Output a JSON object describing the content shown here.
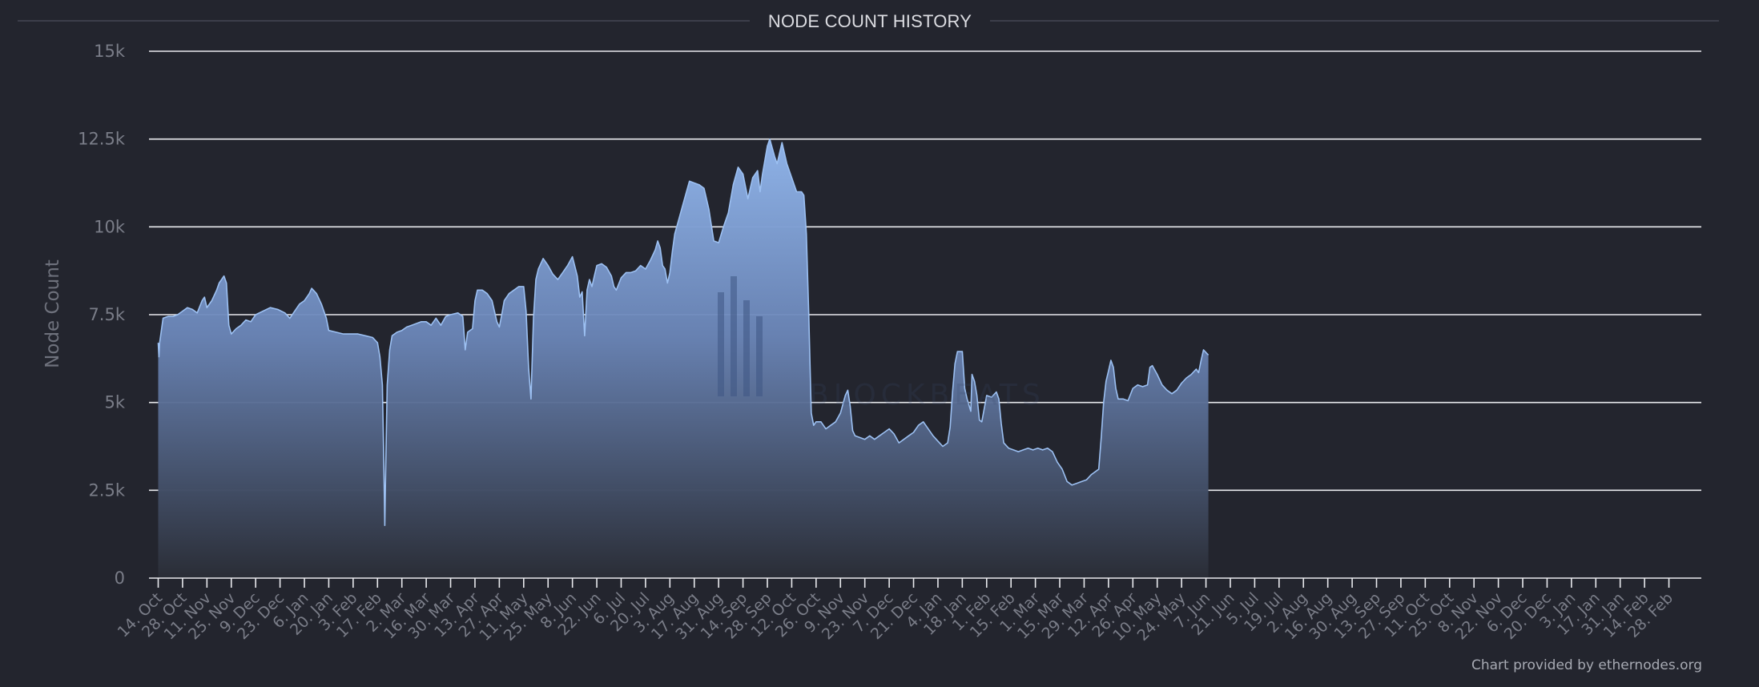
{
  "chart_data": {
    "type": "area",
    "title": "NODE COUNT HISTORY",
    "ylabel": "Node Count",
    "ylim": [
      0,
      15000
    ],
    "yticks": [
      0,
      2500,
      5000,
      7500,
      10000,
      12500,
      15000
    ],
    "ytick_labels": [
      "0",
      "2.5k",
      "5k",
      "7.5k",
      "10k",
      "12.5k",
      "15k"
    ],
    "xtick_labels": [
      "14. Oct",
      "28. Oct",
      "11. Nov",
      "25. Nov",
      "9. Dec",
      "23. Dec",
      "6. Jan",
      "20. Jan",
      "3. Feb",
      "17. Feb",
      "2. Mar",
      "16. Mar",
      "30. Mar",
      "13. Apr",
      "27. Apr",
      "11. May",
      "25. May",
      "8. Jun",
      "22. Jun",
      "6. Jul",
      "20. Jul",
      "3. Aug",
      "17. Aug",
      "31. Aug",
      "14. Sep",
      "28. Sep",
      "12. Oct",
      "26. Oct",
      "9. Nov",
      "23. Nov",
      "7. Dec",
      "21. Dec",
      "4. Jan",
      "18. Jan",
      "1. Feb",
      "15. Feb",
      "1. Mar",
      "15. Mar",
      "29. Mar",
      "12. Apr",
      "26. Apr",
      "10. May",
      "24. May",
      "7. Jun",
      "21. Jun",
      "5. Jul",
      "19. Jul",
      "2. Aug",
      "16. Aug",
      "30. Aug",
      "13. Sep",
      "27. Sep",
      "11. Oct",
      "25. Oct",
      "8. Nov",
      "22. Nov",
      "6. Dec",
      "20. Dec",
      "3. Jan",
      "17. Jan",
      "31. Jan",
      "14. Feb",
      "28. Feb"
    ],
    "grid": true,
    "series": [
      {
        "points": [
          [
            0.0,
            6700
          ],
          [
            0.03,
            6300
          ],
          [
            0.06,
            6700
          ],
          [
            0.2,
            7400
          ],
          [
            0.4,
            7450
          ],
          [
            0.6,
            7450
          ],
          [
            0.8,
            7500
          ],
          [
            1.0,
            7600
          ],
          [
            1.2,
            7700
          ],
          [
            1.4,
            7650
          ],
          [
            1.6,
            7550
          ],
          [
            1.8,
            7900
          ],
          [
            1.9,
            8000
          ],
          [
            2.0,
            7700
          ],
          [
            2.2,
            7900
          ],
          [
            2.4,
            8200
          ],
          [
            2.5,
            8400
          ],
          [
            2.6,
            8500
          ],
          [
            2.7,
            8600
          ],
          [
            2.8,
            8400
          ],
          [
            2.9,
            7200
          ],
          [
            3.0,
            6950
          ],
          [
            3.2,
            7100
          ],
          [
            3.4,
            7200
          ],
          [
            3.6,
            7350
          ],
          [
            3.8,
            7300
          ],
          [
            4.0,
            7500
          ],
          [
            4.3,
            7600
          ],
          [
            4.6,
            7700
          ],
          [
            4.9,
            7650
          ],
          [
            5.2,
            7550
          ],
          [
            5.4,
            7400
          ],
          [
            5.6,
            7600
          ],
          [
            5.8,
            7800
          ],
          [
            6.0,
            7900
          ],
          [
            6.2,
            8100
          ],
          [
            6.3,
            8250
          ],
          [
            6.5,
            8100
          ],
          [
            6.7,
            7800
          ],
          [
            6.9,
            7400
          ],
          [
            7.0,
            7050
          ],
          [
            7.3,
            7000
          ],
          [
            7.6,
            6950
          ],
          [
            7.9,
            6950
          ],
          [
            8.2,
            6950
          ],
          [
            8.5,
            6900
          ],
          [
            8.8,
            6850
          ],
          [
            9.0,
            6700
          ],
          [
            9.1,
            6300
          ],
          [
            9.2,
            5500
          ],
          [
            9.26,
            3200
          ],
          [
            9.3,
            1500
          ],
          [
            9.34,
            3200
          ],
          [
            9.4,
            5500
          ],
          [
            9.5,
            6500
          ],
          [
            9.6,
            6900
          ],
          [
            9.8,
            7000
          ],
          [
            10.0,
            7050
          ],
          [
            10.2,
            7150
          ],
          [
            10.4,
            7200
          ],
          [
            10.6,
            7250
          ],
          [
            10.8,
            7300
          ],
          [
            11.0,
            7300
          ],
          [
            11.2,
            7200
          ],
          [
            11.4,
            7400
          ],
          [
            11.6,
            7200
          ],
          [
            11.8,
            7450
          ],
          [
            12.0,
            7500
          ],
          [
            12.3,
            7550
          ],
          [
            12.5,
            7450
          ],
          [
            12.6,
            6500
          ],
          [
            12.7,
            7000
          ],
          [
            12.9,
            7100
          ],
          [
            13.0,
            7900
          ],
          [
            13.1,
            8200
          ],
          [
            13.3,
            8200
          ],
          [
            13.5,
            8100
          ],
          [
            13.7,
            7900
          ],
          [
            13.9,
            7300
          ],
          [
            14.0,
            7150
          ],
          [
            14.1,
            7500
          ],
          [
            14.2,
            7900
          ],
          [
            14.4,
            8100
          ],
          [
            14.6,
            8200
          ],
          [
            14.8,
            8300
          ],
          [
            15.0,
            8300
          ],
          [
            15.1,
            7600
          ],
          [
            15.2,
            6000
          ],
          [
            15.3,
            5100
          ],
          [
            15.4,
            7400
          ],
          [
            15.5,
            8500
          ],
          [
            15.6,
            8800
          ],
          [
            15.8,
            9100
          ],
          [
            16.0,
            8900
          ],
          [
            16.2,
            8650
          ],
          [
            16.4,
            8500
          ],
          [
            16.6,
            8700
          ],
          [
            16.8,
            8900
          ],
          [
            17.0,
            9150
          ],
          [
            17.2,
            8600
          ],
          [
            17.3,
            8000
          ],
          [
            17.4,
            8150
          ],
          [
            17.5,
            6900
          ],
          [
            17.6,
            8200
          ],
          [
            17.7,
            8500
          ],
          [
            17.8,
            8300
          ],
          [
            17.9,
            8600
          ],
          [
            18.0,
            8900
          ],
          [
            18.2,
            8950
          ],
          [
            18.4,
            8850
          ],
          [
            18.6,
            8600
          ],
          [
            18.7,
            8300
          ],
          [
            18.8,
            8200
          ],
          [
            19.0,
            8550
          ],
          [
            19.2,
            8700
          ],
          [
            19.4,
            8700
          ],
          [
            19.6,
            8750
          ],
          [
            19.8,
            8900
          ],
          [
            20.0,
            8800
          ],
          [
            20.2,
            9050
          ],
          [
            20.4,
            9350
          ],
          [
            20.5,
            9600
          ],
          [
            20.6,
            9400
          ],
          [
            20.7,
            8900
          ],
          [
            20.8,
            8800
          ],
          [
            20.9,
            8400
          ],
          [
            21.0,
            8700
          ],
          [
            21.1,
            9300
          ],
          [
            21.2,
            9800
          ],
          [
            21.4,
            10300
          ],
          [
            21.6,
            10800
          ],
          [
            21.8,
            11300
          ],
          [
            22.0,
            11250
          ],
          [
            22.2,
            11200
          ],
          [
            22.4,
            11100
          ],
          [
            22.6,
            10500
          ],
          [
            22.8,
            9600
          ],
          [
            23.0,
            9550
          ],
          [
            23.2,
            10000
          ],
          [
            23.4,
            10400
          ],
          [
            23.6,
            11200
          ],
          [
            23.8,
            11700
          ],
          [
            24.0,
            11500
          ],
          [
            24.2,
            10800
          ],
          [
            24.4,
            11400
          ],
          [
            24.6,
            11600
          ],
          [
            24.7,
            11000
          ],
          [
            24.8,
            11500
          ],
          [
            25.0,
            12300
          ],
          [
            25.1,
            12500
          ],
          [
            25.3,
            12000
          ],
          [
            25.4,
            11800
          ],
          [
            25.6,
            12400
          ],
          [
            25.8,
            11800
          ],
          [
            26.0,
            11400
          ],
          [
            26.2,
            11000
          ],
          [
            26.4,
            11000
          ],
          [
            26.5,
            10900
          ],
          [
            26.6,
            9800
          ],
          [
            26.7,
            7500
          ],
          [
            26.8,
            4700
          ],
          [
            26.9,
            4350
          ],
          [
            27.0,
            4450
          ],
          [
            27.2,
            4450
          ],
          [
            27.4,
            4250
          ],
          [
            27.6,
            4350
          ],
          [
            27.8,
            4450
          ],
          [
            28.0,
            4700
          ],
          [
            28.2,
            5200
          ],
          [
            28.3,
            5350
          ],
          [
            28.4,
            4900
          ],
          [
            28.5,
            4200
          ],
          [
            28.6,
            4050
          ],
          [
            28.8,
            4000
          ],
          [
            29.0,
            3950
          ],
          [
            29.2,
            4050
          ],
          [
            29.4,
            3950
          ],
          [
            29.6,
            4050
          ],
          [
            29.8,
            4150
          ],
          [
            30.0,
            4250
          ],
          [
            30.2,
            4100
          ],
          [
            30.4,
            3850
          ],
          [
            30.6,
            3950
          ],
          [
            30.8,
            4050
          ],
          [
            31.0,
            4150
          ],
          [
            31.2,
            4350
          ],
          [
            31.4,
            4450
          ],
          [
            31.6,
            4250
          ],
          [
            31.8,
            4050
          ],
          [
            32.0,
            3900
          ],
          [
            32.2,
            3750
          ],
          [
            32.4,
            3850
          ],
          [
            32.5,
            4300
          ],
          [
            32.6,
            5300
          ],
          [
            32.7,
            6100
          ],
          [
            32.8,
            6450
          ],
          [
            33.0,
            6450
          ],
          [
            33.1,
            5400
          ],
          [
            33.2,
            5100
          ],
          [
            33.35,
            4750
          ],
          [
            33.4,
            5800
          ],
          [
            33.5,
            5600
          ],
          [
            33.6,
            5200
          ],
          [
            33.7,
            4500
          ],
          [
            33.8,
            4450
          ],
          [
            34.0,
            5200
          ],
          [
            34.2,
            5150
          ],
          [
            34.4,
            5300
          ],
          [
            34.5,
            5100
          ],
          [
            34.6,
            4400
          ],
          [
            34.7,
            3850
          ],
          [
            34.9,
            3700
          ],
          [
            35.1,
            3650
          ],
          [
            35.3,
            3600
          ],
          [
            35.5,
            3650
          ],
          [
            35.7,
            3700
          ],
          [
            35.9,
            3650
          ],
          [
            36.1,
            3700
          ],
          [
            36.3,
            3650
          ],
          [
            36.5,
            3700
          ],
          [
            36.7,
            3600
          ],
          [
            36.9,
            3300
          ],
          [
            37.1,
            3100
          ],
          [
            37.3,
            2750
          ],
          [
            37.5,
            2650
          ],
          [
            37.7,
            2700
          ],
          [
            37.9,
            2750
          ],
          [
            38.1,
            2800
          ],
          [
            38.3,
            2950
          ],
          [
            38.5,
            3050
          ],
          [
            38.6,
            3100
          ],
          [
            38.7,
            4000
          ],
          [
            38.8,
            5000
          ],
          [
            38.9,
            5600
          ],
          [
            39.0,
            5900
          ],
          [
            39.1,
            6200
          ],
          [
            39.2,
            6000
          ],
          [
            39.3,
            5400
          ],
          [
            39.4,
            5100
          ],
          [
            39.6,
            5100
          ],
          [
            39.8,
            5050
          ],
          [
            40.0,
            5400
          ],
          [
            40.2,
            5500
          ],
          [
            40.4,
            5450
          ],
          [
            40.6,
            5500
          ],
          [
            40.7,
            6000
          ],
          [
            40.8,
            6050
          ],
          [
            41.0,
            5800
          ],
          [
            41.2,
            5500
          ],
          [
            41.4,
            5350
          ],
          [
            41.6,
            5250
          ],
          [
            41.8,
            5350
          ],
          [
            42.0,
            5550
          ],
          [
            42.2,
            5700
          ],
          [
            42.4,
            5800
          ],
          [
            42.6,
            5950
          ],
          [
            42.7,
            5850
          ],
          [
            42.8,
            6200
          ],
          [
            42.9,
            6500
          ],
          [
            43.1,
            6350
          ]
        ]
      }
    ],
    "watermark": {
      "text": "BLOCKBEATS"
    },
    "credits": "Chart provided by ethernodes.org"
  }
}
